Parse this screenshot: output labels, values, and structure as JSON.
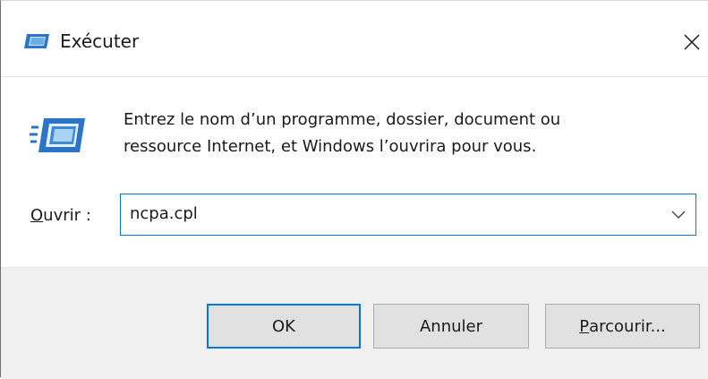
{
  "window": {
    "title": "Exécuter"
  },
  "description": {
    "line1": "Entrez le nom d’un programme, dossier, document ou",
    "line2": "ressource Internet, et Windows l’ouvrira pour vous."
  },
  "open_field": {
    "label_accel": "O",
    "label_rest": "uvrir :",
    "value": "ncpa.cpl"
  },
  "buttons": {
    "ok": "OK",
    "cancel": "Annuler",
    "browse_accel": "P",
    "browse_rest": "arcourir..."
  },
  "icons": {
    "title": "run-icon",
    "main": "run-icon",
    "close": "close-icon",
    "dropdown": "chevron-down-icon"
  },
  "colors": {
    "accent": "#0078d7",
    "footer_bg": "#f0f0f0",
    "button_bg": "#e1e1e1"
  }
}
